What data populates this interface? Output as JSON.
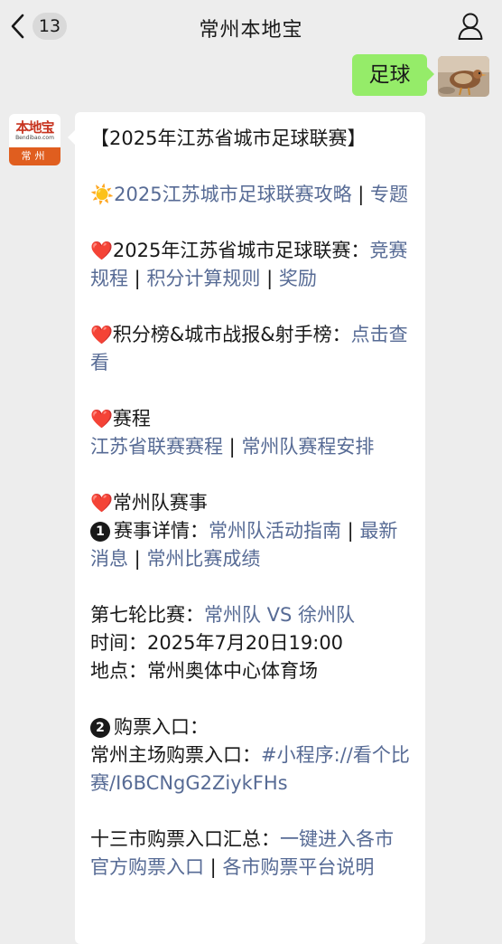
{
  "header": {
    "title": "常州本地宝",
    "unread_count": "13"
  },
  "outgoing": {
    "text": "足球"
  },
  "account": {
    "logo_name": "本地宝",
    "logo_sub": "Bendibao.com",
    "logo_city": "常州"
  },
  "message": {
    "heading": "【2025年江苏省城市足球联赛】",
    "p1": {
      "icon": "sun-icon",
      "link1": "2025江苏城市足球联赛攻略",
      "sep": " | ",
      "link2": "专题"
    },
    "p2": {
      "icon": "heart-icon",
      "text": "2025年江苏省城市足球联赛：",
      "link1": "竞赛规程",
      "sep1": " | ",
      "link2": "积分计算规则",
      "sep2": " | ",
      "link3": "奖励"
    },
    "p3": {
      "icon": "heart-icon",
      "text": "积分榜&城市战报&射手榜：",
      "link1": "点击查看"
    },
    "p4": {
      "icon": "heart-icon",
      "text": "赛程",
      "link1": "江苏省联赛赛程",
      "sep": " | ",
      "link2": "常州队赛程安排"
    },
    "p5": {
      "icon": "heart-icon",
      "text": "常州队赛事",
      "num": "1",
      "label": "赛事详情：",
      "link1": "常州队活动指南",
      "sep1": " | ",
      "link2": "最新消息",
      "sep2": " | ",
      "link3": "常州比赛成绩"
    },
    "p6": {
      "round_label": "第七轮比赛：",
      "round_link": "常州队 VS 徐州队",
      "time_line": "时间：2025年7月20日19:00",
      "place_line": "地点：常州奥体中心体育场"
    },
    "p7": {
      "num": "2",
      "label": "购票入口：",
      "home_label": "常州主场购票入口：",
      "home_link": "#小程序://看个比赛/I6BCNgG2ZiykFHs"
    },
    "p8": {
      "label": "十三市购票入口汇总：",
      "link1": "一键进入各市官方购票入口",
      "sep": " | ",
      "link2": "各市购票平台说明"
    }
  },
  "colors": {
    "background": "#ededed",
    "bubble_out": "#95ec69",
    "bubble_in": "#ffffff",
    "link": "#576b95",
    "logo_orange": "#e05e1f"
  }
}
